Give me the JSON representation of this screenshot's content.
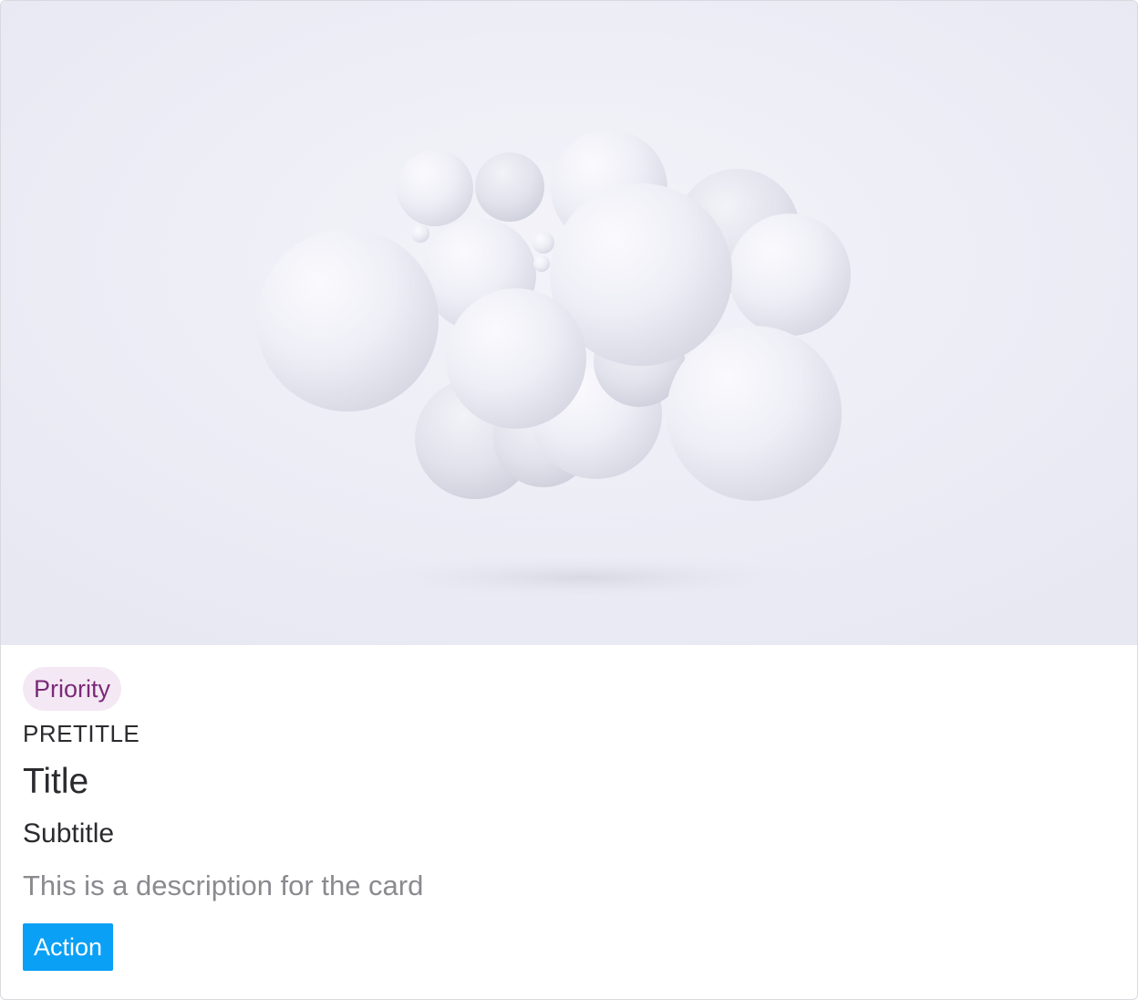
{
  "card": {
    "image_alt": "",
    "badge": "Priority",
    "pretitle": "PRETITLE",
    "title": "Title",
    "subtitle": "Subtitle",
    "description": "This is a description for the card",
    "action_label": "Action"
  },
  "colors": {
    "badge_bg": "#f4e8f4",
    "badge_text": "#7a2a78",
    "action_bg": "#0aa0f5",
    "action_text": "#ffffff",
    "title_text": "#2b2b2f",
    "description_text": "#8a8a8f",
    "image_bg": "#ecebf5"
  }
}
